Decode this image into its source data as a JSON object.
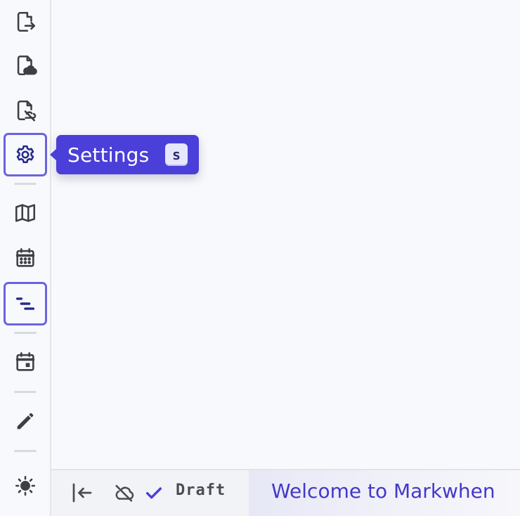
{
  "sidebar": {
    "items": [
      {
        "name": "export-icon"
      },
      {
        "name": "cloud-file-icon"
      },
      {
        "name": "file-off-icon"
      },
      {
        "name": "settings-gear-icon",
        "active": true
      },
      {
        "name": "map-icon"
      },
      {
        "name": "calendar-grid-icon"
      },
      {
        "name": "timeline-icon",
        "active": true
      },
      {
        "name": "calendar-day-icon"
      },
      {
        "name": "pencil-icon"
      },
      {
        "name": "sun-icon"
      }
    ]
  },
  "tooltip": {
    "label": "Settings",
    "shortcut": "s"
  },
  "bottombar": {
    "collapse_icon": "collapse-left-icon",
    "cloud_icon": "cloud-off-icon",
    "check_icon": "check-icon",
    "status": "Draft",
    "document_title": "Welcome to Markwhen"
  },
  "colors": {
    "accent": "#4b3fd9",
    "title": "#4338ca",
    "active_border": "#6a63e0",
    "icon": "#3d3f46"
  }
}
